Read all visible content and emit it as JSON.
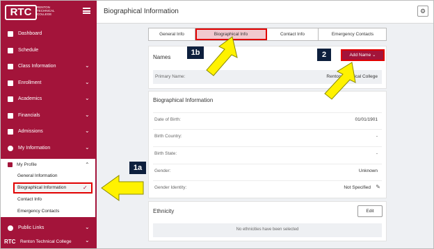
{
  "sidebar": {
    "logo_text": "RTC",
    "logo_subtitle": "RENTON TECHNICAL COLLEGE",
    "items": [
      {
        "label": "Dashboard",
        "icon": "home-icon"
      },
      {
        "label": "Schedule",
        "icon": "calendar-icon"
      },
      {
        "label": "Class Information",
        "icon": "list-icon",
        "chevron": "⌄"
      },
      {
        "label": "Enrollment",
        "icon": "graduation-cap-icon",
        "chevron": "⌄"
      },
      {
        "label": "Academics",
        "icon": "academics-icon",
        "chevron": "⌄"
      },
      {
        "label": "Financials",
        "icon": "credit-card-icon",
        "chevron": "⌄"
      },
      {
        "label": "Admissions",
        "icon": "id-card-icon",
        "chevron": "⌄"
      },
      {
        "label": "My Information",
        "icon": "info-icon",
        "chevron": "⌄"
      }
    ],
    "profile": {
      "label": "My Profile",
      "items": [
        "General Information",
        "Biographical Information",
        "Contact Info",
        "Emergency Contacts"
      ]
    },
    "public_links": "Public Links",
    "college_switcher": "Renton Technical College",
    "footer_logo": "RTC"
  },
  "header": {
    "title": "Biographical Information"
  },
  "tabs": [
    "General Info",
    "Biographical Info",
    "Contact Info",
    "Emergency Contacts"
  ],
  "names_card": {
    "title": "Names",
    "add_button": "Add Name",
    "primary_label": "Primary Name:",
    "primary_value": "Renton Technical College"
  },
  "bio_card": {
    "title": "Biographical Information",
    "rows": [
      {
        "label": "Date of Birth:",
        "value": "01/01/1901"
      },
      {
        "label": "Birth Country:",
        "value": "-"
      },
      {
        "label": "Birth State:",
        "value": "-"
      },
      {
        "label": "Gender:",
        "value": "Unknown"
      },
      {
        "label": "Gender Identity:",
        "value": "Not Specified"
      }
    ]
  },
  "ethnicity_card": {
    "title": "Ethnicity",
    "edit_button": "Edit",
    "empty_text": "No ethnicities have been selected"
  },
  "callouts": {
    "step_1a": "1a",
    "step_1b": "1b",
    "step_2": "2"
  },
  "colors": {
    "brand": "#a3143a",
    "highlight": "#e10000",
    "arrow": "#fff200",
    "callout": "#0d1f3d"
  }
}
